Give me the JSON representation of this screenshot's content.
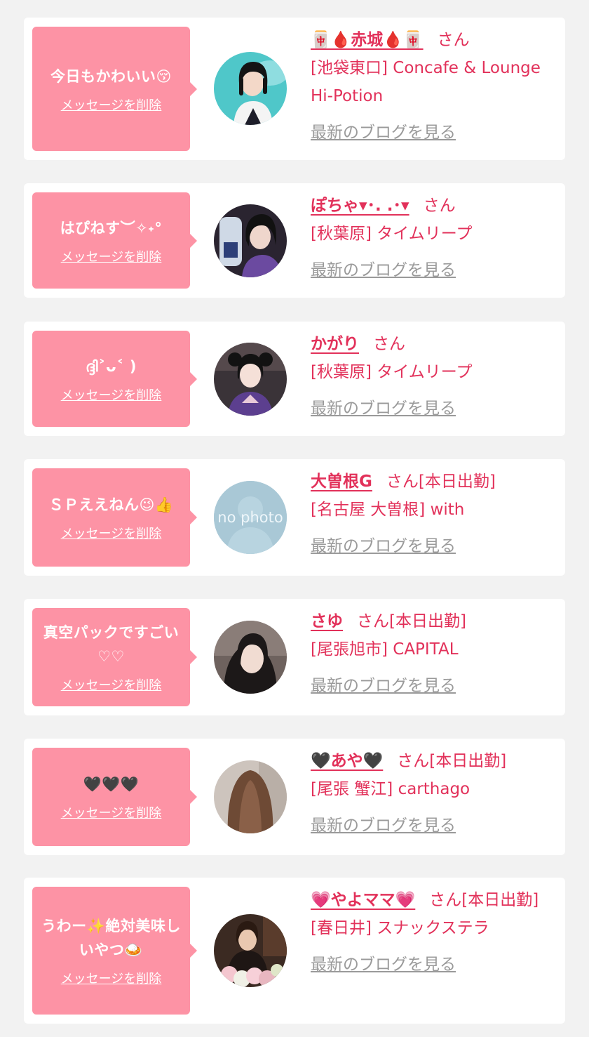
{
  "colors": {
    "page_bg": "#f2f2f2",
    "card_bg": "#ffffff",
    "bubble_bg": "#fd93a5",
    "accent_text": "#e2315a",
    "muted_link": "#9a9a9a"
  },
  "delete_label": "メッセージを削除",
  "blog_label": "最新のブログを見る",
  "honorific": "さん",
  "items": [
    {
      "message": "今日もかわいい😚",
      "name": "🀄🩸赤城🩸🀄",
      "status": "",
      "shop": "[池袋東口] Concafe & Lounge Hi-Potion",
      "avatar_desc": "short black hair, teal background"
    },
    {
      "message": "はぴねす︶✧˖°",
      "name": "ぽちゃ▾･. .･▾",
      "status": "",
      "shop": "[秋葉原] タイムリープ",
      "avatar_desc": "dark-haired girl holding bottle"
    },
    {
      "message": "ദ്ദി˃ᴗ˂ )",
      "name": "かがり",
      "status": "",
      "shop": "[秋葉原] タイムリープ",
      "avatar_desc": "twin-tail girl in purple kimono"
    },
    {
      "message": "ＳＰええねん😉👍",
      "name": "大曽根G",
      "status": "[本日出勤]",
      "shop": "[名古屋 大曽根] with",
      "avatar_desc": "no photo"
    },
    {
      "message": "真空パックですごい♡♡",
      "name": "さゆ",
      "status": "[本日出勤]",
      "shop": "[尾張旭市] CAPITAL",
      "avatar_desc": "long dark hair portrait"
    },
    {
      "message": "🖤🖤🖤",
      "name": "🖤あや🖤",
      "status": "[本日出勤]",
      "shop": "[尾張 蟹江] carthago",
      "avatar_desc": "brown hair from behind"
    },
    {
      "message": "うわー✨絶対美味しいやつ🍛",
      "name": "💗やよママ💗",
      "status": "[本日出勤]",
      "shop": "[春日井] スナックステラ",
      "avatar_desc": "woman with flower bouquet"
    }
  ]
}
